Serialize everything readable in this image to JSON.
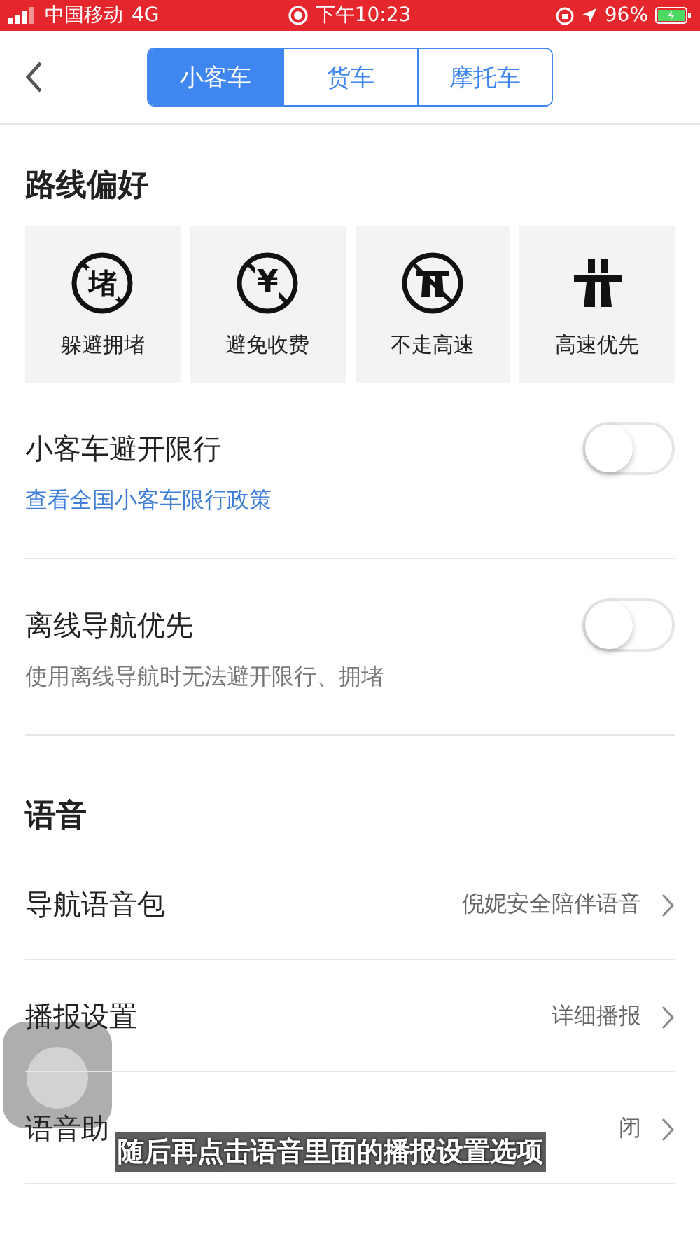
{
  "status_bar": {
    "carrier": "中国移动",
    "network": "4G",
    "time": "下午10:23",
    "battery": "96%"
  },
  "nav": {
    "tabs": [
      {
        "label": "小客车",
        "selected": true
      },
      {
        "label": "货车",
        "selected": false
      },
      {
        "label": "摩托车",
        "selected": false
      }
    ]
  },
  "route_preferences": {
    "title": "路线偏好",
    "options": [
      {
        "kind": "no-jam",
        "label": "躲避拥堵",
        "glyph": "堵"
      },
      {
        "kind": "no-toll",
        "label": "避免收费",
        "glyph": "¥"
      },
      {
        "kind": "no-highway",
        "label": "不走高速"
      },
      {
        "kind": "highway",
        "label": "高速优先"
      }
    ]
  },
  "toggles": [
    {
      "label": "小客车避开限行",
      "on": false,
      "link": "查看全国小客车限行政策"
    },
    {
      "label": "离线导航优先",
      "on": false,
      "note": "使用离线导航时无法避开限行、拥堵"
    }
  ],
  "voice": {
    "title": "语音",
    "rows": [
      {
        "label": "导航语音包",
        "value": "倪妮安全陪伴语音"
      },
      {
        "label": "播报设置",
        "value": "详细播报"
      },
      {
        "label": "语音助",
        "value": "闭"
      }
    ]
  },
  "caption": "随后再点击语音里面的播报设置选项"
}
